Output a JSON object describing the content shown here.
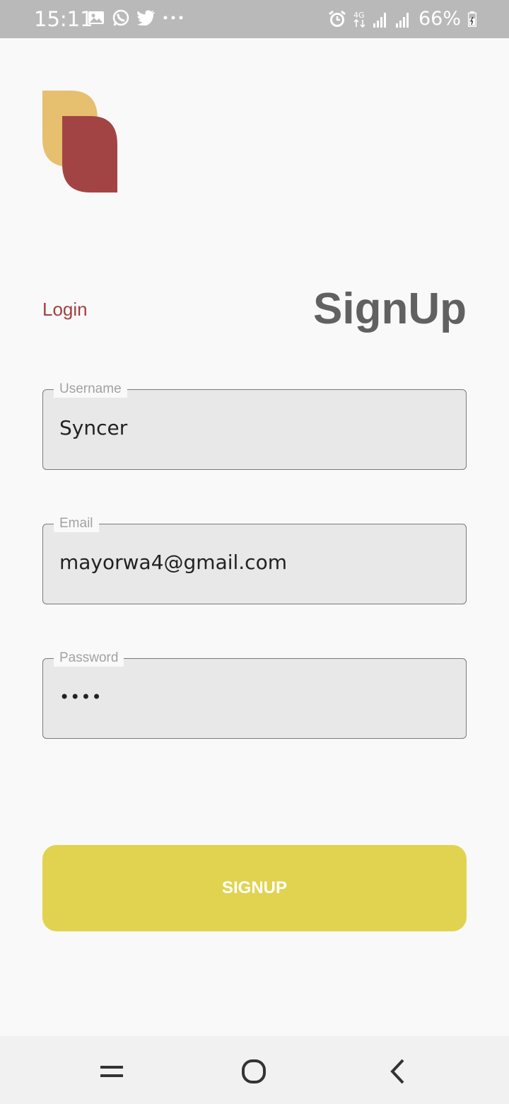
{
  "status_bar": {
    "time": "15:11",
    "left_icons": [
      "gallery-icon",
      "whatsapp-icon",
      "twitter-icon",
      "more-dots-icon"
    ],
    "network": "4G",
    "battery": "66%"
  },
  "header": {
    "login_label": "Login",
    "title": "SignUp"
  },
  "form": {
    "username": {
      "label": "Username",
      "value": "Syncer"
    },
    "email": {
      "label": "Email",
      "value": "mayorwa4@gmail.com"
    },
    "password": {
      "label": "Password",
      "value": "••••"
    }
  },
  "actions": {
    "signup_label": "SIGNUP"
  },
  "colors": {
    "accent_red": "#a04141",
    "logo_yellow": "#e6c06f",
    "logo_red": "#a34444",
    "button_yellow": "#e1d34f"
  },
  "nav": {
    "icons": [
      "recent-apps-icon",
      "home-icon",
      "back-icon"
    ]
  }
}
